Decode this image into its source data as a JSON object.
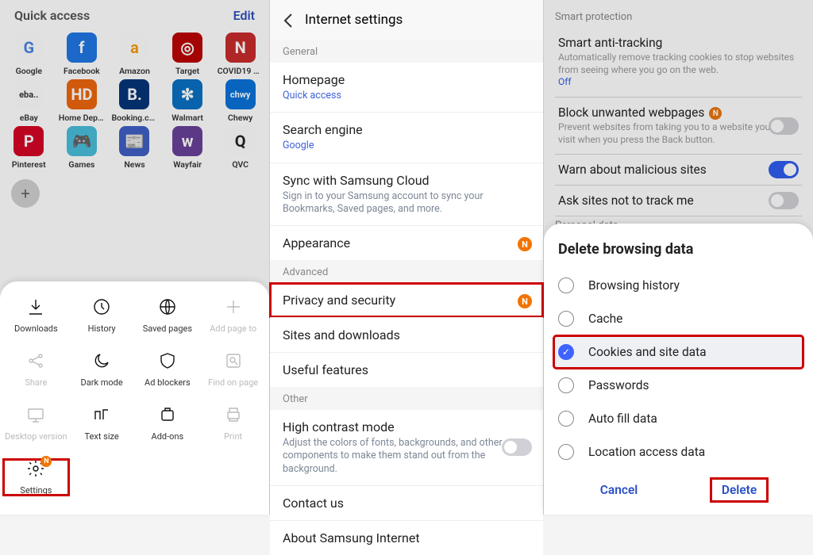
{
  "pane1": {
    "title": "Quick access",
    "edit": "Edit",
    "tiles": [
      {
        "label": "Google",
        "bg": "#fff",
        "fg": "#4285f4",
        "glyph": "G"
      },
      {
        "label": "Facebook",
        "bg": "#1877f2",
        "glyph": "f"
      },
      {
        "label": "Amazon",
        "bg": "#fff",
        "fg": "#ff9900",
        "glyph": "a"
      },
      {
        "label": "Target",
        "bg": "#cc0000",
        "glyph": "◎"
      },
      {
        "label": "COVID19 U…",
        "bg": "#d62828",
        "glyph": "N"
      },
      {
        "label": "eBay",
        "bg": "#fff",
        "fg": "#333",
        "glyph": "eba.."
      },
      {
        "label": "Home Depot",
        "bg": "#f96302",
        "glyph": "HD"
      },
      {
        "label": "Booking.com",
        "bg": "#003580",
        "glyph": "B."
      },
      {
        "label": "Walmart",
        "bg": "#0071ce",
        "glyph": "✻"
      },
      {
        "label": "Chewy",
        "bg": "#0073e6",
        "glyph": "chwy"
      },
      {
        "label": "Pinterest",
        "bg": "#e60023",
        "glyph": "P"
      },
      {
        "label": "Games",
        "bg": "#3fbfe0",
        "glyph": "🎮"
      },
      {
        "label": "News",
        "bg": "#3b5ecf",
        "glyph": "📰"
      },
      {
        "label": "Wayfair",
        "bg": "#6b3fa0",
        "glyph": "w"
      },
      {
        "label": "QVC",
        "bg": "#fff",
        "fg": "#222",
        "glyph": "Q"
      }
    ],
    "menu": [
      {
        "name": "downloads",
        "label": "Downloads",
        "icon": "download-icon"
      },
      {
        "name": "history",
        "label": "History",
        "icon": "clock-icon"
      },
      {
        "name": "saved-pages",
        "label": "Saved pages",
        "icon": "globe-arrow-icon"
      },
      {
        "name": "add-page",
        "label": "Add page to",
        "icon": "plus-icon",
        "disabled": true
      },
      {
        "name": "share",
        "label": "Share",
        "icon": "share-icon",
        "disabled": true
      },
      {
        "name": "dark-mode",
        "label": "Dark mode",
        "icon": "moon-icon"
      },
      {
        "name": "ad-blockers",
        "label": "Ad blockers",
        "icon": "shield-icon"
      },
      {
        "name": "find",
        "label": "Find on page",
        "icon": "find-icon",
        "disabled": true
      },
      {
        "name": "desktop",
        "label": "Desktop version",
        "icon": "desktop-icon",
        "disabled": true
      },
      {
        "name": "text-size",
        "label": "Text size",
        "icon": "text-size-icon"
      },
      {
        "name": "addons",
        "label": "Add-ons",
        "icon": "addons-icon"
      },
      {
        "name": "print",
        "label": "Print",
        "icon": "print-icon",
        "disabled": true
      },
      {
        "name": "settings",
        "label": "Settings",
        "icon": "gear-icon",
        "badge": true,
        "highlight": true
      }
    ]
  },
  "pane2": {
    "title": "Internet settings",
    "groups": [
      {
        "header": "General",
        "rows": [
          {
            "title": "Homepage",
            "sub": "Quick access",
            "sublink": true
          },
          {
            "title": "Search engine",
            "sub": "Google",
            "sublink": true
          },
          {
            "title": "Sync with Samsung Cloud",
            "sub": "Sign in to your Samsung account to sync your Bookmarks, Saved pages, and more."
          },
          {
            "title": "Appearance",
            "badge": true
          }
        ]
      },
      {
        "header": "Advanced",
        "rows": [
          {
            "title": "Privacy and security",
            "badge": true,
            "highlight": true
          },
          {
            "title": "Sites and downloads"
          },
          {
            "title": "Useful features"
          }
        ]
      },
      {
        "header": "Other",
        "rows": [
          {
            "title": "High contrast mode",
            "sub": "Adjust the colors of fonts, backgrounds, and other components to make them stand out from the background.",
            "toggle": "off"
          },
          {
            "title": "Contact us"
          },
          {
            "title": "About Samsung Internet"
          }
        ]
      }
    ]
  },
  "pane3": {
    "section_smart": "Smart protection",
    "rows": [
      {
        "title": "Smart anti-tracking",
        "sub": "Automatically remove tracking cookies to stop websites from seeing where you go on the web.",
        "status": "Off"
      },
      {
        "title": "Block unwanted webpages",
        "sub": "Prevent websites from taking you to a website you didn't visit when you press the Back button.",
        "badge": true,
        "toggle": "off"
      },
      {
        "title": "Warn about malicious sites",
        "toggle": "on"
      },
      {
        "title": "Ask sites not to track me",
        "toggle": "off"
      }
    ],
    "section_personal": "Personal data",
    "sheet": {
      "title": "Delete browsing data",
      "options": [
        {
          "label": "Browsing history",
          "selected": false
        },
        {
          "label": "Cache",
          "selected": false
        },
        {
          "label": "Cookies and site data",
          "selected": true,
          "highlight": true
        },
        {
          "label": "Passwords",
          "selected": false
        },
        {
          "label": "Auto fill data",
          "selected": false
        },
        {
          "label": "Location access data",
          "selected": false
        }
      ],
      "cancel": "Cancel",
      "delete": "Delete"
    }
  }
}
